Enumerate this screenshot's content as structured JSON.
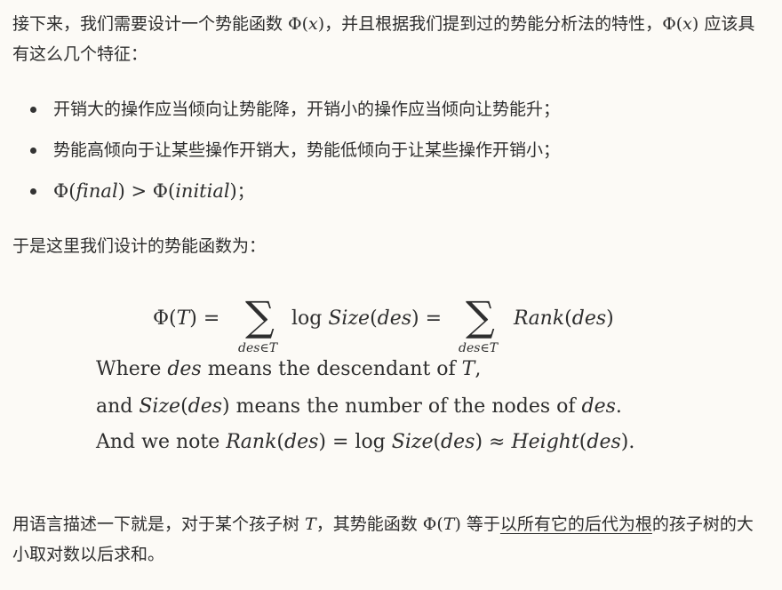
{
  "intro": {
    "text1": "接下来，我们需要设计一个势能函数 ",
    "phi_x": "Φ(𝑥)",
    "text2": "，并且根据我们提到过的势能分析法的特性，",
    "text3": " 应该具有这么几个特征："
  },
  "bullets": [
    "开销大的操作应当倾向让势能降，开销小的操作应当倾向让势能升；",
    "势能高倾向于让某些操作开销大，势能低倾向于让某些操作开销小；"
  ],
  "bullet3": {
    "left": "Φ(𝑓𝑖𝑛𝑎𝑙) > Φ(𝑖𝑛𝑖𝑡𝑖𝑎𝑙)",
    "suffix": "；"
  },
  "lead": "于是这里我们设计的势能函数为：",
  "formula": {
    "lhs": "Φ(𝑇) =",
    "sigma": "∑",
    "sum1_sub": "des∈T",
    "term1": "log 𝑆𝑖𝑧𝑒(𝑑𝑒𝑠) =",
    "sum2_sub": "des∈T",
    "term2": "𝑅𝑎𝑛𝑘(𝑑𝑒𝑠)"
  },
  "notes": [
    "Where 𝑑𝑒𝑠 means the descendant of 𝑇,",
    "and 𝑆𝑖𝑧𝑒(𝑑𝑒𝑠) means the number of the nodes of 𝑑𝑒𝑠.",
    "And we note 𝑅𝑎𝑛𝑘(𝑑𝑒𝑠) = log 𝑆𝑖𝑧𝑒(𝑑𝑒𝑠) ≈ 𝐻𝑒𝑖𝑔ℎ𝑡(𝑑𝑒𝑠)."
  ],
  "outro": {
    "text1": "用语言描述一下就是，对于某个孩子树 ",
    "T": "𝑇",
    "text2": "，其势能函数 ",
    "phi_T": "Φ(𝑇)",
    "text3": " 等于",
    "underlined": "以所有它的后代为根",
    "text4": "的孩子树的大小取对数以后求和。"
  }
}
